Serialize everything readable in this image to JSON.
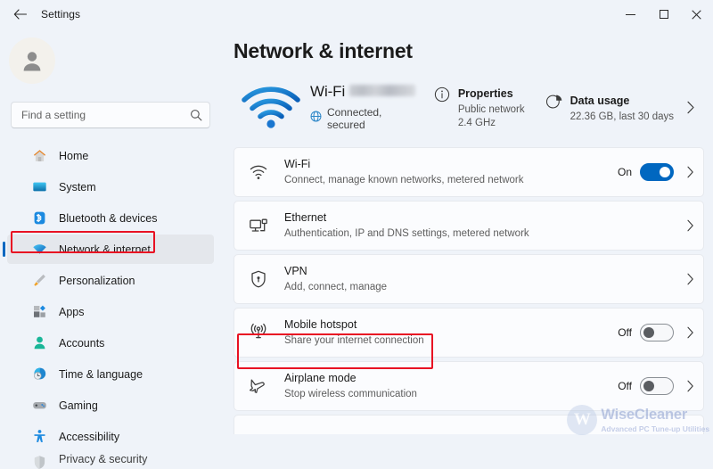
{
  "window": {
    "title": "Settings",
    "back_icon": "back-arrow-icon",
    "minimize_label": "Minimize",
    "maximize_label": "Maximize",
    "close_label": "Close"
  },
  "sidebar": {
    "avatar_icon": "user-avatar-icon",
    "search": {
      "placeholder": "Find a setting",
      "value": "",
      "icon": "search-icon"
    },
    "items": [
      {
        "label": "Home",
        "icon": "home-icon",
        "selected": false
      },
      {
        "label": "System",
        "icon": "system-icon",
        "selected": false
      },
      {
        "label": "Bluetooth & devices",
        "icon": "bluetooth-icon",
        "selected": false
      },
      {
        "label": "Network & internet",
        "icon": "network-icon",
        "selected": true
      },
      {
        "label": "Personalization",
        "icon": "brush-icon",
        "selected": false
      },
      {
        "label": "Apps",
        "icon": "apps-icon",
        "selected": false
      },
      {
        "label": "Accounts",
        "icon": "accounts-icon",
        "selected": false
      },
      {
        "label": "Time & language",
        "icon": "clock-globe-icon",
        "selected": false
      },
      {
        "label": "Gaming",
        "icon": "gamepad-icon",
        "selected": false
      },
      {
        "label": "Accessibility",
        "icon": "accessibility-icon",
        "selected": false
      },
      {
        "label": "Privacy & security",
        "icon": "shield-icon",
        "selected": false
      }
    ]
  },
  "main": {
    "page_title": "Network & internet",
    "hero": {
      "wifi_icon": "wifi-signal-icon",
      "ssid_prefix": "Wi-Fi",
      "ssid_redacted": true,
      "status_icon": "globe-icon",
      "status_text": "Connected, secured",
      "properties": {
        "icon": "info-circle-icon",
        "title": "Properties",
        "line1": "Public network",
        "line2": "2.4 GHz"
      },
      "data_usage": {
        "icon": "pie-chart-icon",
        "title": "Data usage",
        "line1": "22.36 GB, last 30 days"
      },
      "chevron_icon": "chevron-right-icon"
    },
    "cards": [
      {
        "icon": "wifi-icon",
        "title": "Wi-Fi",
        "subtitle": "Connect, manage known networks, metered network",
        "toggle": {
          "state_label": "On",
          "on": true
        },
        "chevron": true,
        "highlighted": false
      },
      {
        "icon": "ethernet-icon",
        "title": "Ethernet",
        "subtitle": "Authentication, IP and DNS settings, metered network",
        "toggle": null,
        "chevron": true,
        "highlighted": false
      },
      {
        "icon": "vpn-shield-icon",
        "title": "VPN",
        "subtitle": "Add, connect, manage",
        "toggle": null,
        "chevron": true,
        "highlighted": false
      },
      {
        "icon": "hotspot-icon",
        "title": "Mobile hotspot",
        "subtitle": "Share your internet connection",
        "toggle": {
          "state_label": "Off",
          "on": false
        },
        "chevron": true,
        "highlighted": true
      },
      {
        "icon": "airplane-icon",
        "title": "Airplane mode",
        "subtitle": "Stop wireless communication",
        "toggle": {
          "state_label": "Off",
          "on": false
        },
        "chevron": true,
        "highlighted": false
      }
    ]
  },
  "watermark": {
    "badge_letter": "W",
    "name": "WiseCleaner",
    "tagline": "Advanced PC Tune-up Utilities"
  },
  "colors": {
    "accent": "#0067c0",
    "callout": "#e81123",
    "page_bg": "#eff3f9",
    "card_bg": "#fbfcfe",
    "selected_bg": "#e4e7ec"
  }
}
